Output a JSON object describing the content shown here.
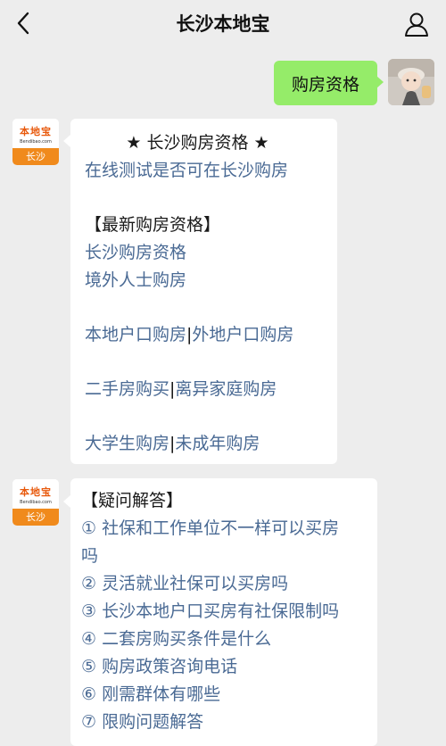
{
  "header": {
    "title": "长沙本地宝",
    "back_icon": "back-chevron-icon",
    "profile_icon": "user-profile-icon"
  },
  "outgoing_message": {
    "text": "购房资格"
  },
  "bot_avatar": {
    "logo_text": "本地宝",
    "logo_sub": "Bendibao.com",
    "city": "长沙"
  },
  "message1": {
    "heading": "★ 长沙购房资格 ★",
    "test_link": "在线测试是否可在长沙购房",
    "section_title": "【最新购房资格】",
    "link_qualification": "长沙购房资格",
    "link_foreign": "境外人士购房",
    "link_local_hukou": "本地户口购房",
    "link_nonlocal_hukou": "外地户口购房",
    "link_second_hand": "二手房购买",
    "link_divorced": "离异家庭购房",
    "link_college": "大学生购房",
    "link_minor": "未成年购房",
    "separator": "|"
  },
  "message2": {
    "section_title": "【疑问解答】",
    "faq": [
      "① 社保和工作单位不一样可以买房",
      "吗",
      "② 灵活就业社保可以买房吗",
      "③ 长沙本地户口买房有社保限制吗",
      "④ 二套房购买条件是什么",
      "⑤ 购房政策咨询电话",
      "⑥ 刚需群体有哪些",
      "⑦ 限购问题解答"
    ]
  },
  "colors": {
    "background": "#ededed",
    "outgoing_bubble": "#95ec69",
    "link": "#4a6a94",
    "brand_orange": "#f08a1c"
  }
}
